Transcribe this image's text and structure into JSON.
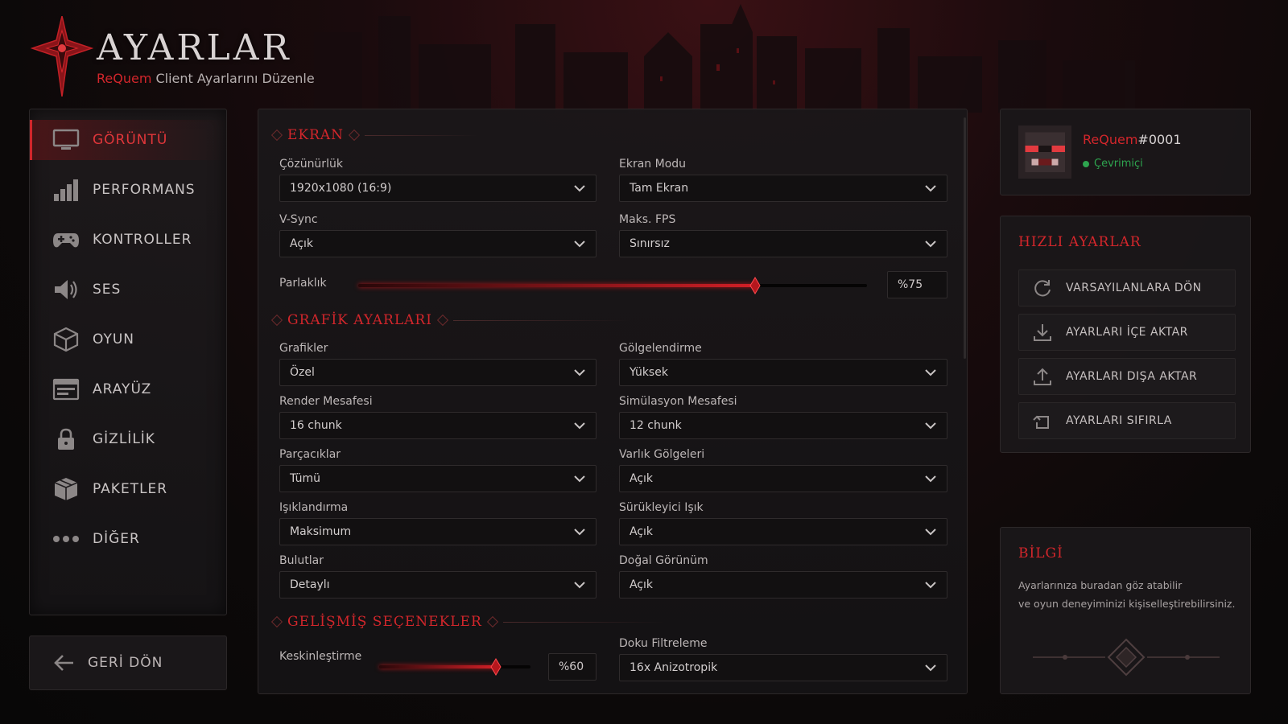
{
  "header": {
    "title": "AYARLAR",
    "subtitle_brand": "ReQuem",
    "subtitle_rest": " Client Ayarlarını Düzenle"
  },
  "colors": {
    "accent": "#d2262b",
    "online": "#2ea44f",
    "panel": "#1a1719"
  },
  "sidebar": {
    "items": [
      {
        "label": "GÖRÜNTÜ",
        "icon": "monitor-icon",
        "active": true
      },
      {
        "label": "PERFORMANS",
        "icon": "bar-chart-icon"
      },
      {
        "label": "KONTROLLER",
        "icon": "gamepad-icon"
      },
      {
        "label": "SES",
        "icon": "speaker-icon"
      },
      {
        "label": "OYUN",
        "icon": "cube-icon"
      },
      {
        "label": "ARAYÜZ",
        "icon": "window-icon"
      },
      {
        "label": "GİZLİLİK",
        "icon": "lock-icon"
      },
      {
        "label": "PAKETLER",
        "icon": "package-icon"
      },
      {
        "label": "DİĞER",
        "icon": "more-dots-icon"
      }
    ],
    "back_label": "GERİ DÖN"
  },
  "screen": {
    "title": "EKRAN",
    "resolution": {
      "label": "Çözünürlük",
      "value": "1920x1080 (16:9)"
    },
    "screen_mode": {
      "label": "Ekran Modu",
      "value": "Tam Ekran"
    },
    "vsync": {
      "label": "V-Sync",
      "value": "Açık"
    },
    "max_fps": {
      "label": "Maks. FPS",
      "value": "Sınırsız"
    },
    "brightness": {
      "label": "Parlaklık",
      "value": "%75",
      "level": 0.78
    }
  },
  "graphics": {
    "title": "GRAFİK AYARLARI",
    "graphics": {
      "label": "Grafikler",
      "value": "Özel"
    },
    "shading": {
      "label": "Gölgelendirme",
      "value": "Yüksek"
    },
    "render_distance": {
      "label": "Render Mesafesi",
      "value": "16 chunk"
    },
    "simulation_distance": {
      "label": "Simülasyon Mesafesi",
      "value": "12 chunk"
    },
    "particles": {
      "label": "Parçacıklar",
      "value": "Tümü"
    },
    "entity_shadows": {
      "label": "Varlık Gölgeleri",
      "value": "Açık"
    },
    "lighting": {
      "label": "Işıklandırma",
      "value": "Maksimum"
    },
    "immersive_light": {
      "label": "Sürükleyici Işık",
      "value": "Açık"
    },
    "clouds": {
      "label": "Bulutlar",
      "value": "Detaylı"
    },
    "natural_view": {
      "label": "Doğal Görünüm",
      "value": "Açık"
    }
  },
  "advanced": {
    "title": "GELİŞMİŞ SEÇENEKLER",
    "sharpening": {
      "label": "Keskinleştirme",
      "value": "%60",
      "level": 0.77
    },
    "texture_filtering": {
      "label": "Doku Filtreleme",
      "value": "16x Anizotropik"
    }
  },
  "profile": {
    "name": "ReQuem",
    "tag": "#0001",
    "status": "Çevrimiçi"
  },
  "quick_settings": {
    "title": "HIZLI AYARLAR",
    "buttons": [
      {
        "label": "VARSAYILANLARA DÖN",
        "icon": "refresh-icon"
      },
      {
        "label": "AYARLARI İÇE AKTAR",
        "icon": "download-icon"
      },
      {
        "label": "AYARLARI DIŞA AKTAR",
        "icon": "upload-icon"
      },
      {
        "label": "AYARLARI SIFIRLA",
        "icon": "reset-icon"
      }
    ]
  },
  "info": {
    "title": "BİLGİ",
    "line1": "Ayarlarınıza buradan göz atabilir",
    "line2": "ve oyun deneyiminizi kişiselleştirebilirsiniz."
  }
}
